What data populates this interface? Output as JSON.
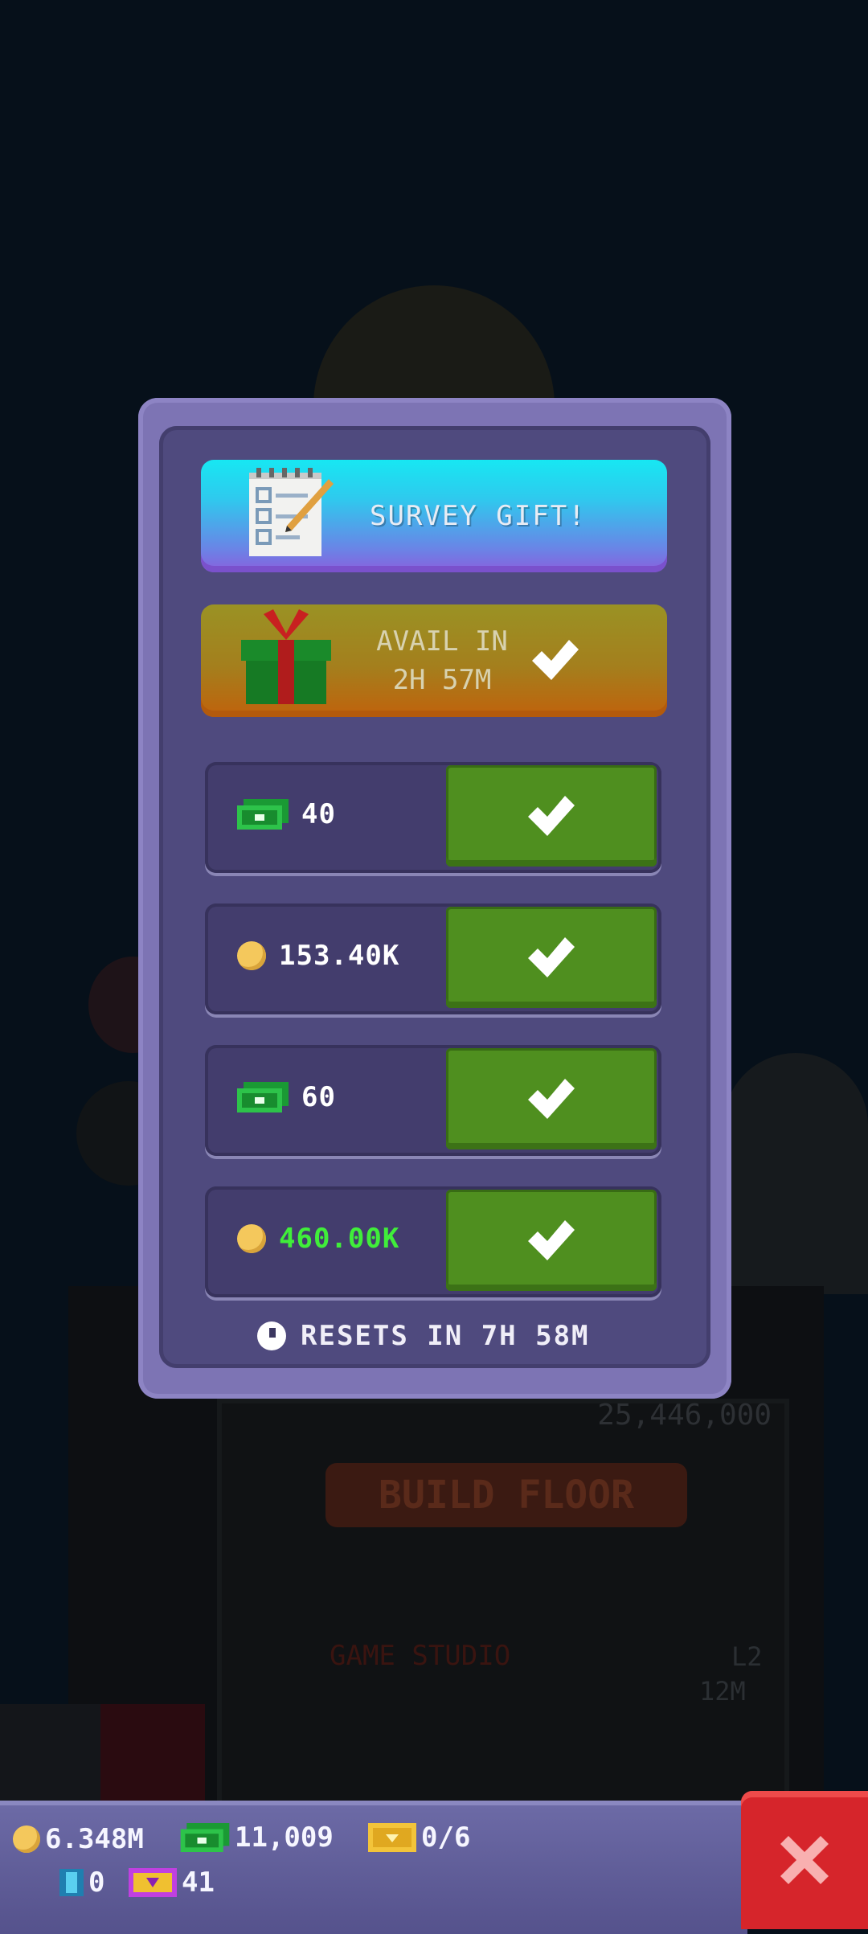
{
  "background": {
    "tower_value": "25,446,000",
    "build_button": "BUILD FLOOR",
    "floor_name": "GAME STUDIO",
    "floor_level": "L2",
    "floor_population": "12M"
  },
  "modal": {
    "survey_banner": "SURVEY GIFT!",
    "gift_banner_line1": "AVAIL IN",
    "gift_banner_line2": "2H 57M",
    "rewards": [
      {
        "currency": "bux",
        "amount": "40"
      },
      {
        "currency": "coins",
        "amount": "153.40K"
      },
      {
        "currency": "bux",
        "amount": "60"
      },
      {
        "currency": "coins",
        "amount": "460.00K",
        "highlight": true
      }
    ],
    "resets_text": "RESETS IN 7H 58M"
  },
  "bottom_bar": {
    "coins": "6.348M",
    "bux": "11,009",
    "tickets": "0/6",
    "elevator_items": "0",
    "golden_tickets": "41"
  },
  "colors": {
    "modal_outer": "#7d74b4",
    "modal_inner": "#4f4a7e",
    "claim_button": "#4f8f1f",
    "close_button": "#d6252b",
    "highlight_text": "#40ee3a"
  },
  "icons": [
    "survey-notepad-icon",
    "gift-box-icon",
    "checkmark-icon",
    "cash-icon",
    "coin-icon",
    "clock-icon",
    "ticket-icon",
    "elevator-icon",
    "close-icon"
  ]
}
